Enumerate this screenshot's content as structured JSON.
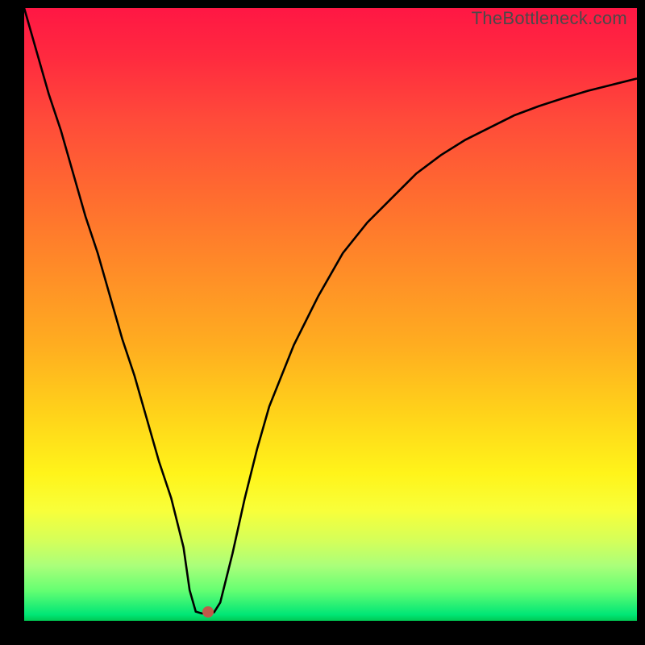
{
  "watermark": "TheBottleneck.com",
  "colors": {
    "curve": "#000000",
    "marker": "#c05a4a",
    "frame": "#000000"
  },
  "chart_data": {
    "type": "line",
    "title": "",
    "xlabel": "",
    "ylabel": "",
    "xlim": [
      0,
      100
    ],
    "ylim": [
      0,
      100
    ],
    "grid": false,
    "x": [
      0,
      2,
      4,
      6,
      8,
      10,
      12,
      14,
      16,
      18,
      20,
      22,
      24,
      26,
      27,
      28,
      29,
      30,
      31,
      32,
      34,
      36,
      38,
      40,
      44,
      48,
      52,
      56,
      60,
      64,
      68,
      72,
      76,
      80,
      84,
      88,
      92,
      96,
      100
    ],
    "values": [
      100,
      93,
      86,
      80,
      73,
      66,
      60,
      53,
      46,
      40,
      33,
      26,
      20,
      12,
      5,
      1.5,
      1.2,
      1.2,
      1.4,
      3,
      11,
      20,
      28,
      35,
      45,
      53,
      60,
      65,
      69,
      73,
      76,
      78.5,
      80.5,
      82.5,
      84,
      85.3,
      86.5,
      87.5,
      88.5
    ],
    "marker": {
      "x": 30,
      "y": 1.5
    },
    "annotations": []
  }
}
